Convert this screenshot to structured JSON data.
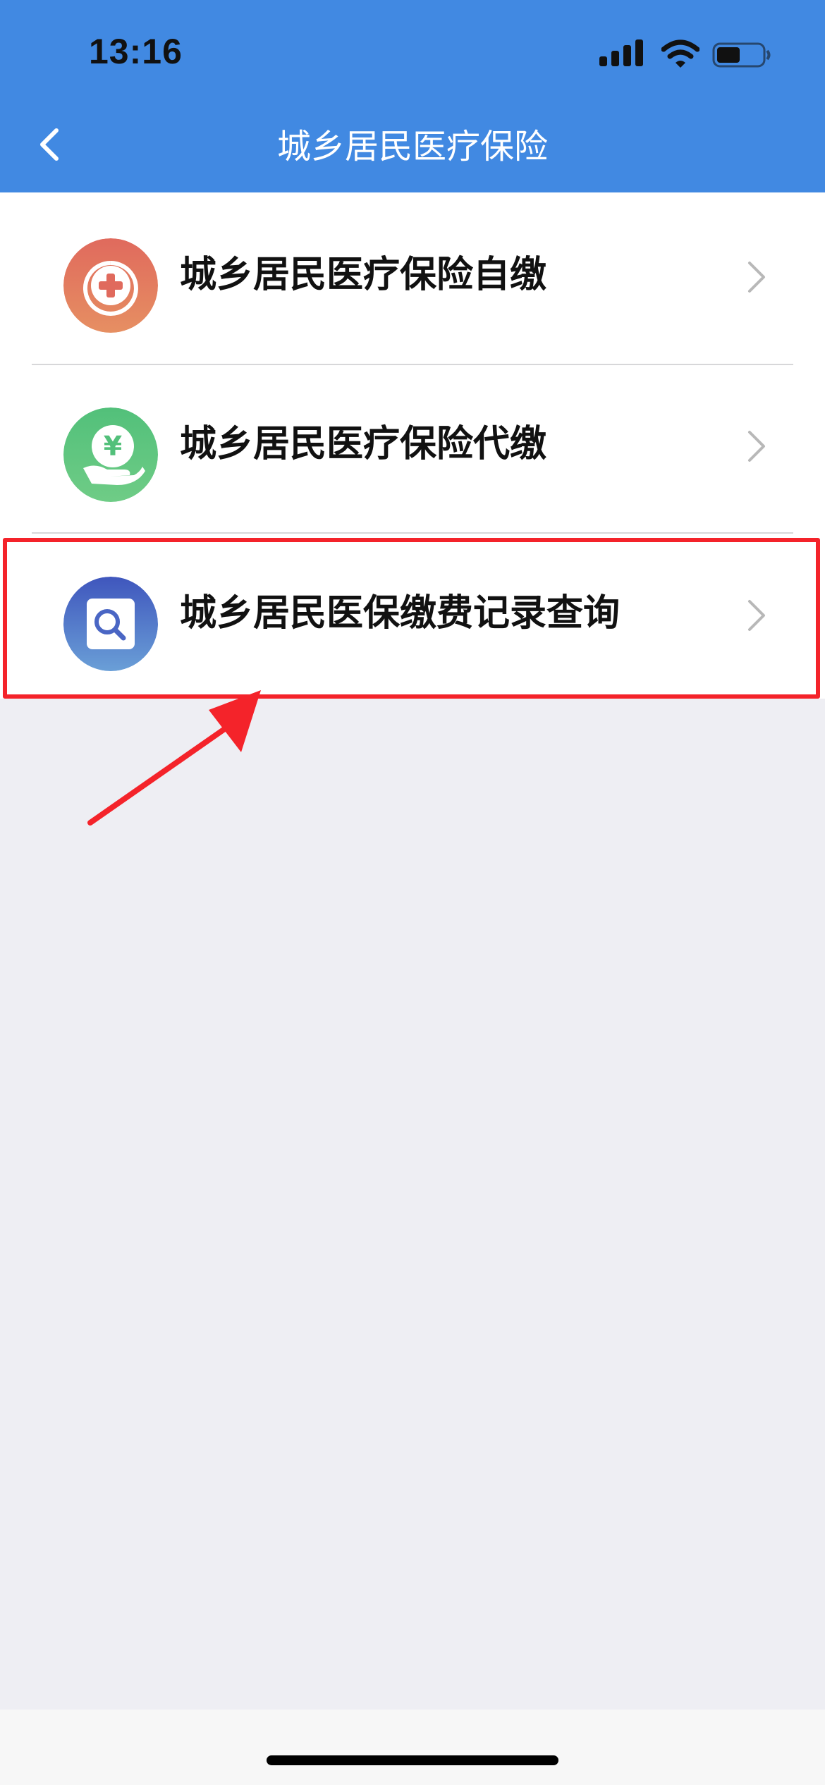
{
  "status_bar": {
    "time": "13:16"
  },
  "nav": {
    "title": "城乡居民医疗保险"
  },
  "items": [
    {
      "label": "城乡居民医疗保险自缴",
      "icon": "medical-cross-icon"
    },
    {
      "label": "城乡居民医疗保险代缴",
      "icon": "yuan-hand-icon"
    },
    {
      "label": "城乡居民医保缴费记录查询",
      "icon": "search-record-icon"
    }
  ],
  "colors": {
    "header": "#4189e2",
    "highlight": "#f4232a",
    "background": "#eeeef3",
    "icon1": "#e3735f",
    "icon2": "#5cc37a",
    "icon3": "#4a66c4"
  }
}
